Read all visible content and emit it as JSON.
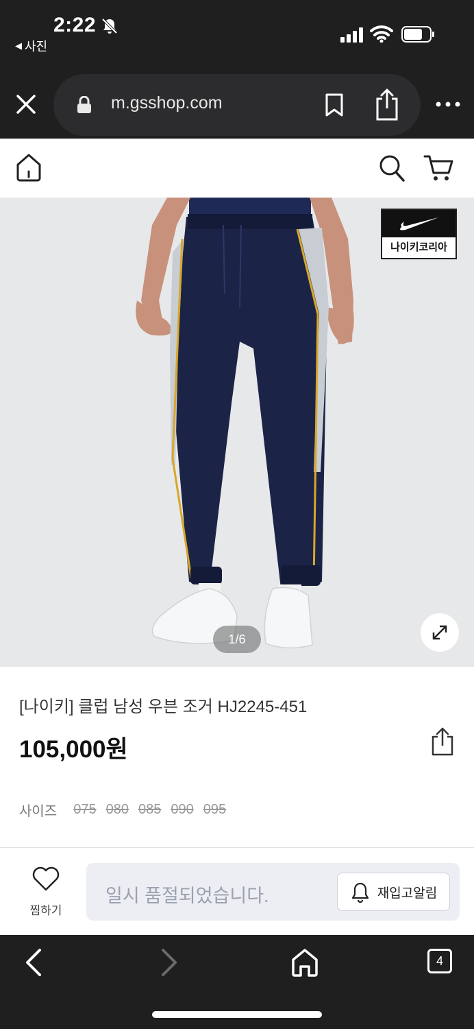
{
  "status_bar": {
    "time": "2:22",
    "back_app": "사진"
  },
  "browser": {
    "url": "m.gsshop.com"
  },
  "gallery": {
    "brand_badge": "나이키코리아",
    "pager": "1/6"
  },
  "product": {
    "title": "[나이키] 클럽 남성 우븐 조거 HJ2245-451",
    "price": "105,000원",
    "size_label": "사이즈",
    "sizes": [
      "075",
      "080",
      "085",
      "090",
      "095"
    ],
    "colors": {
      "pants": "#1b2447",
      "stripe": "#c8cdd4",
      "piping": "#d8a72a"
    }
  },
  "action_bar": {
    "wish_label": "찜하기",
    "soldout_text": "일시 품절되었습니다.",
    "restock_label": "재입고알림"
  },
  "toolbar": {
    "tab_count": "4"
  }
}
